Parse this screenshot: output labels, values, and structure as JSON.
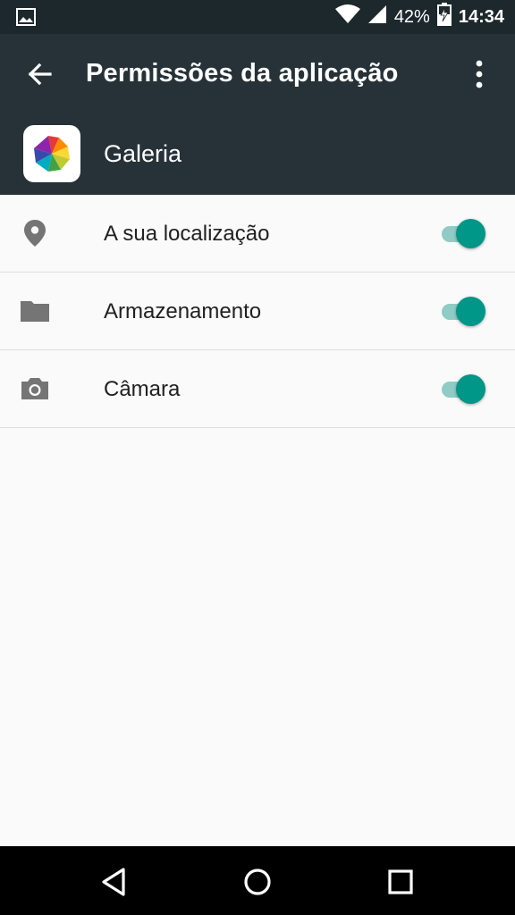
{
  "status_bar": {
    "notification_icon": "image-icon",
    "wifi_icon": "wifi-icon",
    "signal_icon": "cellular-signal-icon",
    "battery_percent": "42%",
    "battery_icon": "battery-charging-icon",
    "time": "14:34"
  },
  "toolbar": {
    "back_icon": "arrow-back-icon",
    "title": "Permissões da aplicação",
    "more_icon": "more-vert-icon"
  },
  "app": {
    "name": "Galeria",
    "icon": "gallery-pinwheel-icon"
  },
  "permissions": [
    {
      "label": "A sua localização",
      "icon": "location-pin-icon",
      "enabled": true
    },
    {
      "label": "Armazenamento",
      "icon": "folder-icon",
      "enabled": true
    },
    {
      "label": "Câmara",
      "icon": "camera-icon",
      "enabled": true
    }
  ],
  "nav_bar": {
    "back": "nav-back-icon",
    "home": "nav-home-icon",
    "recents": "nav-recents-icon"
  },
  "colors": {
    "toolbar_bg": "#263238",
    "status_bar_bg": "#1d282d",
    "accent": "#009688",
    "accent_track": "#8fccc5",
    "background": "#fafafa"
  }
}
